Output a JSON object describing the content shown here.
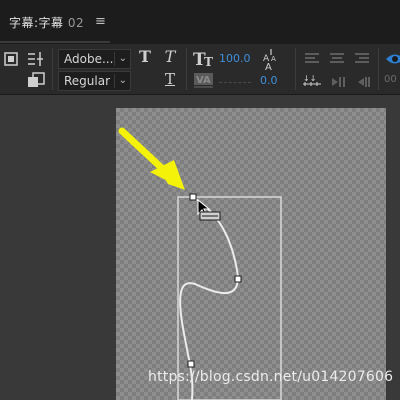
{
  "panel": {
    "title": "字幕:字幕",
    "number": "02",
    "menu_icon": "hamburger-menu-icon"
  },
  "toolbar": {
    "font_family": "Adobe...",
    "font_style": "Regular",
    "font_size": "100.0",
    "tracking": "0.0",
    "icons": [
      "roll-crawl-icon",
      "tab-stops-icon",
      "template-icon",
      "bold-T-icon",
      "italic-T-icon",
      "underline-T-icon",
      "font-size-TT-icon",
      "kerning-VA-icon",
      "aspect-AA-icon",
      "align-left-icon",
      "align-center-icon",
      "align-right-icon",
      "tab-stops-ruler-icon",
      "show-video-icon"
    ]
  },
  "watermark": "https://blog.csdn.net/u014207606",
  "colors": {
    "accent_blue": "#3f8fdc",
    "arrow_yellow": "#f5f20a",
    "panel_bg": "#2a2a2a",
    "checker_light": "#8e8e8e",
    "checker_dark": "#7e7e7e"
  }
}
